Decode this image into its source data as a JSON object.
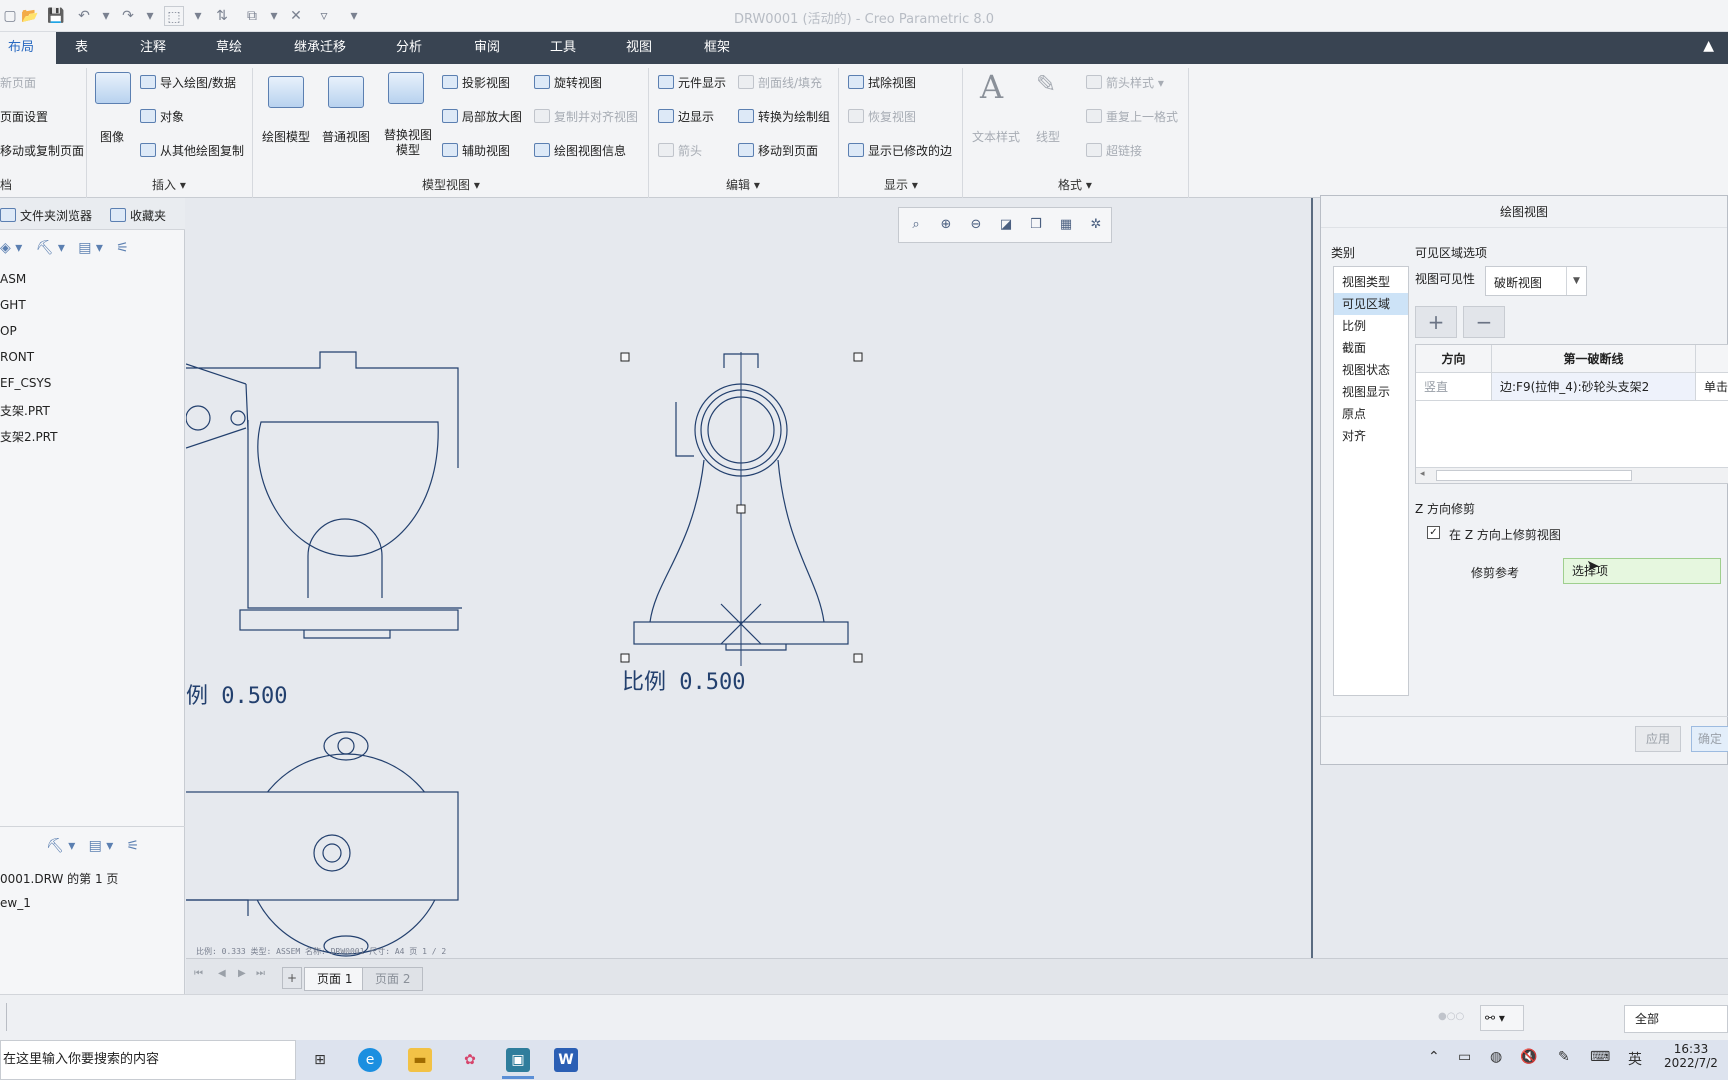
{
  "window": {
    "title": "DRW0001 (活动的) - Creo Parametric 8.0"
  },
  "ribbon_tabs": [
    "布局",
    "表",
    "注释",
    "草绘",
    "继承迁移",
    "分析",
    "审阅",
    "工具",
    "视图",
    "框架"
  ],
  "ribbon": {
    "doc_group": {
      "new_page": "新页面",
      "page_setup": "页面设置",
      "move_copy_page": "移动或复制页面",
      "label": "档"
    },
    "insert_group": {
      "image": "图像",
      "import": "导入绘图/数据",
      "object": "对象",
      "copy_from": "从其他绘图复制",
      "label": "插入"
    },
    "model_view_group": {
      "drawing_model": "绘图模型",
      "general_view": "普通视图",
      "replace_model": "替换视图模型",
      "projection": "投影视图",
      "detail": "局部放大图",
      "auxiliary": "辅助视图",
      "revolve": "旋转视图",
      "copy_align": "复制并对齐视图",
      "view_info": "绘图视图信息",
      "label": "模型视图"
    },
    "edit_group": {
      "component_display": "元件显示",
      "hatching": "剖面线/填充",
      "edge_display": "边显示",
      "convert": "转换为绘制组",
      "arrow": "箭头",
      "move_to_page": "移动到页面",
      "label": "编辑"
    },
    "display_group": {
      "erase": "拭除视图",
      "restore": "恢复视图",
      "show_modified": "显示已修改的边",
      "label": "显示"
    },
    "format_group": {
      "text_style": "文本样式",
      "line_style": "线型",
      "arrow_style": "箭头样式",
      "repeat_format": "重复上一格式",
      "hyperlink": "超链接",
      "label": "格式"
    }
  },
  "left_panel": {
    "tabs": [
      "文件夹浏览器",
      "收藏夹"
    ],
    "tree": [
      "ASM",
      "GHT",
      "OP",
      "RONT",
      "EF_CSYS",
      "支架.PRT",
      "支架2.PRT"
    ],
    "tree2": [
      "0001.DRW 的第 1 页",
      "ew_1"
    ]
  },
  "canvas": {
    "scale_left": "例 0.500",
    "scale_center": "比例 0.500",
    "footer": "比例: 0.333    类型: ASSEM    名称: DRW0001    尺寸: A4    页 1 / 2"
  },
  "page_tabs": [
    "页面 1",
    "页面 2"
  ],
  "status": {
    "filter": "全部"
  },
  "taskbar": {
    "search_placeholder": "在这里输入你要搜索的内容",
    "time": "16:33",
    "date": "2022/7/2",
    "ime": "英"
  },
  "dialog": {
    "title": "绘图视图",
    "category_label": "类别",
    "categories": [
      "视图类型",
      "可见区域",
      "比例",
      "截面",
      "视图状态",
      "视图显示",
      "原点",
      "对齐"
    ],
    "section_title": "可见区域选项",
    "visibility_label": "视图可见性",
    "visibility_value": "破断视图",
    "table_headers": [
      "方向",
      "第一破断线"
    ],
    "row": {
      "direction": "竖直",
      "break": "边:F9(拉伸_4):砂轮头支架2",
      "extra": "单击"
    },
    "z_trim_title": "Z 方向修剪",
    "z_trim_checkbox": "在 Z 方向上修剪视图",
    "trim_ref_label": "修剪参考",
    "trim_ref_value": "选择项",
    "apply": "应用",
    "ok": "确定"
  }
}
